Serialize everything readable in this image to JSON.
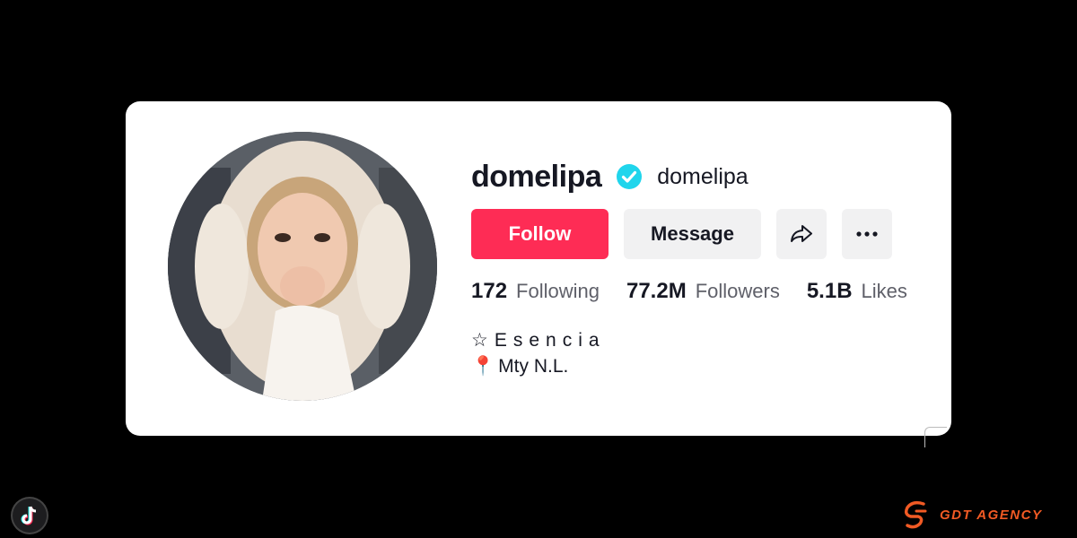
{
  "profile": {
    "username": "domelipa",
    "nickname": "domelipa",
    "verified": true,
    "avatar_icon": "profile-photo"
  },
  "actions": {
    "follow_label": "Follow",
    "message_label": "Message",
    "share_icon": "share-arrow-icon",
    "more_icon": "more-dots-icon"
  },
  "stats": [
    {
      "value": "172",
      "label": "Following"
    },
    {
      "value": "77.2M",
      "label": "Followers"
    },
    {
      "value": "5.1B",
      "label": "Likes"
    }
  ],
  "bio": {
    "line1": "☆Esencia",
    "line2_icon": "📍",
    "line2": "Mty N.L."
  },
  "watermark": {
    "agency": "GDT AGENCY"
  },
  "colors": {
    "follow": "#fe2c55",
    "verified": "#20d5ec",
    "agency": "#f15a24"
  }
}
